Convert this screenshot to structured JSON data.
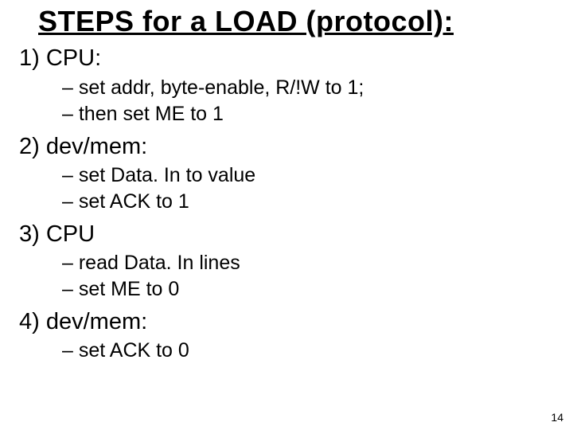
{
  "title": "STEPS for a LOAD (protocol):",
  "steps": [
    {
      "heading": "1) CPU:",
      "subs": [
        "– set addr, byte-enable, R/!W to 1;",
        "– then set ME to 1"
      ]
    },
    {
      "heading": "2) dev/mem:",
      "subs": [
        "– set Data. In to value",
        "– set ACK to 1"
      ]
    },
    {
      "heading": "3) CPU",
      "subs": [
        "– read Data. In lines",
        "– set ME to 0"
      ]
    },
    {
      "heading": "4) dev/mem:",
      "subs": [
        "– set ACK to 0"
      ]
    }
  ],
  "page_number": "14"
}
